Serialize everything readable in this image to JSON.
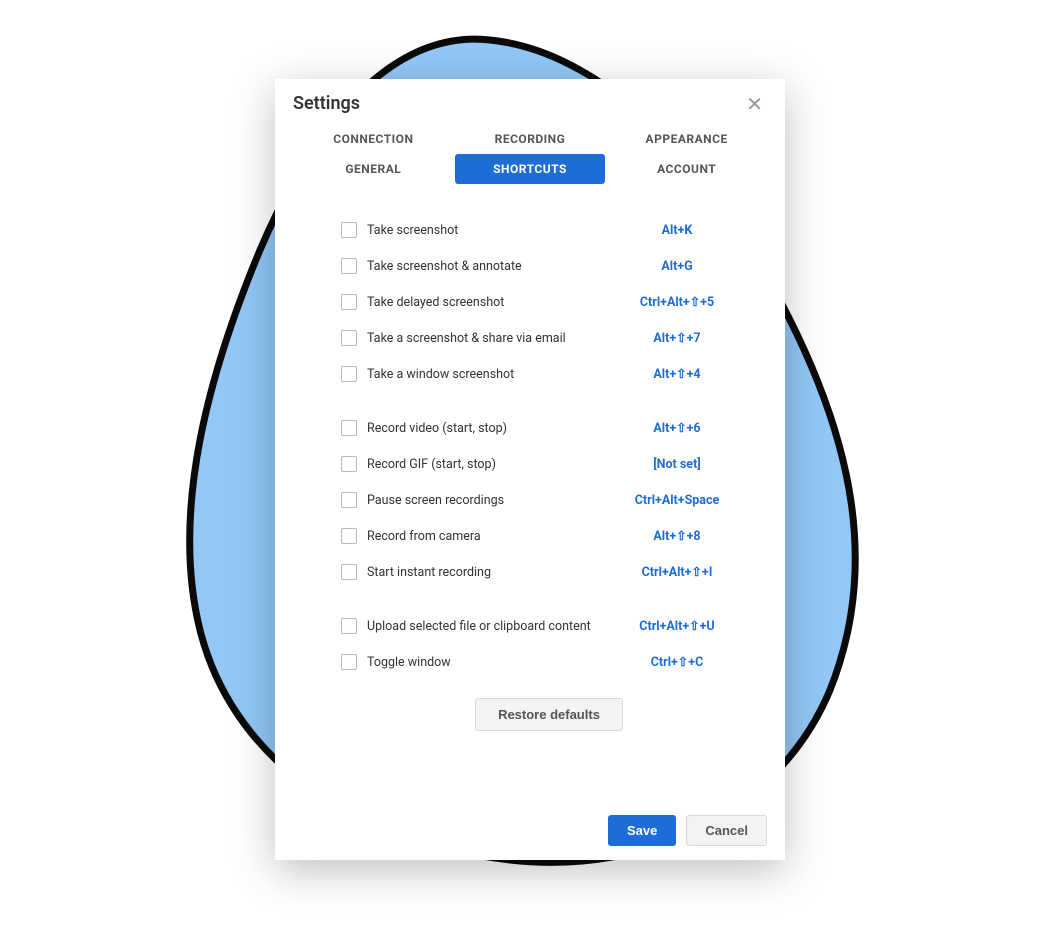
{
  "dialog": {
    "title": "Settings",
    "tabs_row1": [
      "CONNECTION",
      "RECORDING",
      "APPEARANCE"
    ],
    "tabs_row2": [
      "GENERAL",
      "SHORTCUTS",
      "ACCOUNT"
    ],
    "active_tab": "SHORTCUTS"
  },
  "shortcuts": {
    "group1": [
      {
        "label": "Take screenshot",
        "key": "Alt+K"
      },
      {
        "label": "Take screenshot & annotate",
        "key": "Alt+G"
      },
      {
        "label": "Take delayed screenshot",
        "key": "Ctrl+Alt+⇧+5"
      },
      {
        "label": "Take a screenshot & share via email",
        "key": "Alt+⇧+7"
      },
      {
        "label": "Take a window screenshot",
        "key": "Alt+⇧+4"
      }
    ],
    "group2": [
      {
        "label": "Record video (start, stop)",
        "key": "Alt+⇧+6"
      },
      {
        "label": "Record GIF (start, stop)",
        "key": "[Not set]"
      },
      {
        "label": "Pause screen recordings",
        "key": "Ctrl+Alt+Space"
      },
      {
        "label": "Record from camera",
        "key": "Alt+⇧+8"
      },
      {
        "label": "Start instant recording",
        "key": "Ctrl+Alt+⇧+I"
      }
    ],
    "group3": [
      {
        "label": "Upload selected file or clipboard content",
        "key": "Ctrl+Alt+⇧+U"
      },
      {
        "label": "Toggle window",
        "key": "Ctrl+⇧+C"
      }
    ]
  },
  "buttons": {
    "restore": "Restore defaults",
    "save": "Save",
    "cancel": "Cancel"
  },
  "colors": {
    "accent": "#1e6dd6",
    "blob": "#92c7f6"
  }
}
